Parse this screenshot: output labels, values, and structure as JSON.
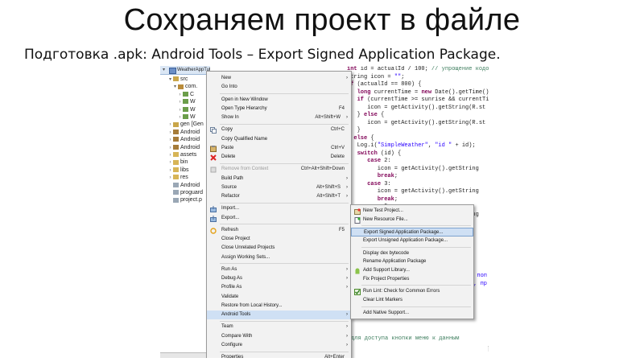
{
  "slide": {
    "title": "Сохраняем проект в файле",
    "subtitle": "Подготовка .apk: Android Tools – Export Signed Application Package."
  },
  "tree": {
    "project": "WeatherAppTutorial",
    "rows": [
      {
        "label": "src",
        "arrow": "▾"
      },
      {
        "label": "com.",
        "arrow": "▾"
      },
      {
        "label": "C",
        "arrow": "›"
      },
      {
        "label": "W",
        "arrow": "›"
      },
      {
        "label": "W",
        "arrow": "›"
      },
      {
        "label": "W",
        "arrow": "›"
      },
      {
        "label": "gen [Gen",
        "arrow": "›"
      },
      {
        "label": "Android",
        "arrow": "›"
      },
      {
        "label": "Android",
        "arrow": "›"
      },
      {
        "label": "Android",
        "arrow": "›"
      },
      {
        "label": "assets",
        "arrow": "›"
      },
      {
        "label": "bin",
        "arrow": "›"
      },
      {
        "label": "libs",
        "arrow": "›"
      },
      {
        "label": "res",
        "arrow": "›"
      },
      {
        "label": "Android",
        "arrow": ""
      },
      {
        "label": "proguard",
        "arrow": ""
      },
      {
        "label": "project.p",
        "arrow": ""
      }
    ]
  },
  "code": {
    "lines": [
      "int id = actualId / 100; // упрощение кодо",
      "String icon = \"\";",
      "if (actualId == 800) {",
      "   long currentTime = new Date().getTime()",
      "   if (currentTime >= sunrise && currentTi",
      "      icon = getActivity().getString(R.st",
      "   } else {",
      "      icon = getActivity().getString(R.st",
      "   }",
      "} else {",
      "   Log.i(\"SimpleWeather\", \"id \" + id);",
      "   switch (id) {",
      "      case 2:",
      "         icon = getActivity().getString",
      "         break;",
      "      case 3:",
      "         icon = getActivity().getString",
      "         break;",
      "      case 5:",
      "         icon = getActivity().getString"
    ],
    "bottom_lines": [
      ":weatherIcon.setText(icon);",
      "для доступа кнопки меню к данным"
    ],
    "right_peek": [
      "и поп",
      "ю, пр"
    ]
  },
  "menu": {
    "items": [
      {
        "label": "New",
        "shortcut": "",
        "submenu": true,
        "disabled": false,
        "icon": ""
      },
      {
        "label": "Go Into",
        "shortcut": "",
        "submenu": false,
        "disabled": false,
        "icon": ""
      },
      {
        "sep": true
      },
      {
        "label": "Open in New Window",
        "shortcut": "",
        "submenu": false,
        "disabled": false,
        "icon": ""
      },
      {
        "label": "Open Type Hierarchy",
        "shortcut": "F4",
        "submenu": false,
        "disabled": false,
        "icon": ""
      },
      {
        "label": "Show In",
        "shortcut": "Alt+Shift+W",
        "submenu": true,
        "disabled": false,
        "icon": ""
      },
      {
        "sep": true
      },
      {
        "label": "Copy",
        "shortcut": "Ctrl+C",
        "submenu": false,
        "disabled": false,
        "icon": "copy-icon"
      },
      {
        "label": "Copy Qualified Name",
        "shortcut": "",
        "submenu": false,
        "disabled": false,
        "icon": ""
      },
      {
        "label": "Paste",
        "shortcut": "Ctrl+V",
        "submenu": false,
        "disabled": false,
        "icon": "paste-icon"
      },
      {
        "label": "Delete",
        "shortcut": "Delete",
        "submenu": false,
        "disabled": false,
        "icon": "delete-icon"
      },
      {
        "sep": true
      },
      {
        "label": "Remove from Context",
        "shortcut": "Ctrl+Alt+Shift+Down",
        "submenu": false,
        "disabled": true,
        "icon": "remove-context-icon"
      },
      {
        "label": "Build Path",
        "shortcut": "",
        "submenu": true,
        "disabled": false,
        "icon": ""
      },
      {
        "label": "Source",
        "shortcut": "Alt+Shift+S",
        "submenu": true,
        "disabled": false,
        "icon": ""
      },
      {
        "label": "Refactor",
        "shortcut": "Alt+Shift+T",
        "submenu": true,
        "disabled": false,
        "icon": ""
      },
      {
        "sep": true
      },
      {
        "label": "Import...",
        "shortcut": "",
        "submenu": false,
        "disabled": false,
        "icon": "import-icon"
      },
      {
        "label": "Export...",
        "shortcut": "",
        "submenu": false,
        "disabled": false,
        "icon": "export-icon"
      },
      {
        "sep": true
      },
      {
        "label": "Refresh",
        "shortcut": "F5",
        "submenu": false,
        "disabled": false,
        "icon": "refresh-icon"
      },
      {
        "label": "Close Project",
        "shortcut": "",
        "submenu": false,
        "disabled": false,
        "icon": ""
      },
      {
        "label": "Close Unrelated Projects",
        "shortcut": "",
        "submenu": false,
        "disabled": false,
        "icon": ""
      },
      {
        "label": "Assign Working Sets...",
        "shortcut": "",
        "submenu": false,
        "disabled": false,
        "icon": ""
      },
      {
        "sep": true
      },
      {
        "label": "Run As",
        "shortcut": "",
        "submenu": true,
        "disabled": false,
        "icon": ""
      },
      {
        "label": "Debug As",
        "shortcut": "",
        "submenu": true,
        "disabled": false,
        "icon": ""
      },
      {
        "label": "Profile As",
        "shortcut": "",
        "submenu": true,
        "disabled": false,
        "icon": ""
      },
      {
        "label": "Validate",
        "shortcut": "",
        "submenu": false,
        "disabled": false,
        "icon": ""
      },
      {
        "label": "Restore from Local History...",
        "shortcut": "",
        "submenu": false,
        "disabled": false,
        "icon": ""
      },
      {
        "label": "Android Tools",
        "shortcut": "",
        "submenu": true,
        "disabled": false,
        "icon": "",
        "highlight": true
      },
      {
        "sep": true
      },
      {
        "label": "Team",
        "shortcut": "",
        "submenu": true,
        "disabled": false,
        "icon": ""
      },
      {
        "label": "Compare With",
        "shortcut": "",
        "submenu": true,
        "disabled": false,
        "icon": ""
      },
      {
        "label": "Configure",
        "shortcut": "",
        "submenu": true,
        "disabled": false,
        "icon": ""
      },
      {
        "sep": true
      },
      {
        "label": "Properties",
        "shortcut": "Alt+Enter",
        "submenu": false,
        "disabled": false,
        "icon": ""
      }
    ]
  },
  "android_tools_submenu": {
    "items": [
      {
        "label": "New Test Project...",
        "icon": "new-test-project-icon"
      },
      {
        "label": "New Resource File...",
        "icon": "new-resource-file-icon"
      },
      {
        "sep": true
      },
      {
        "label": "Export Signed Application Package...",
        "highlight": true
      },
      {
        "label": "Export Unsigned Application Package..."
      },
      {
        "sep": true
      },
      {
        "label": "Display dex bytecode"
      },
      {
        "label": "Rename Application Package"
      },
      {
        "label": "Add Support Library...",
        "icon": "android-icon"
      },
      {
        "label": "Fix Project Properties"
      },
      {
        "sep": true
      },
      {
        "label": "Run Lint: Check for Common Errors",
        "icon": "lint-check-icon"
      },
      {
        "label": "Clear Lint Markers"
      },
      {
        "sep": true
      },
      {
        "label": "Add Native Support..."
      }
    ]
  },
  "colors": {
    "highlight": "#cfe0f4",
    "menu_bg": "#f2f2f2",
    "disabled_text": "#9a9a9a",
    "keyword": "#7f0055",
    "string": "#2a00ff"
  }
}
